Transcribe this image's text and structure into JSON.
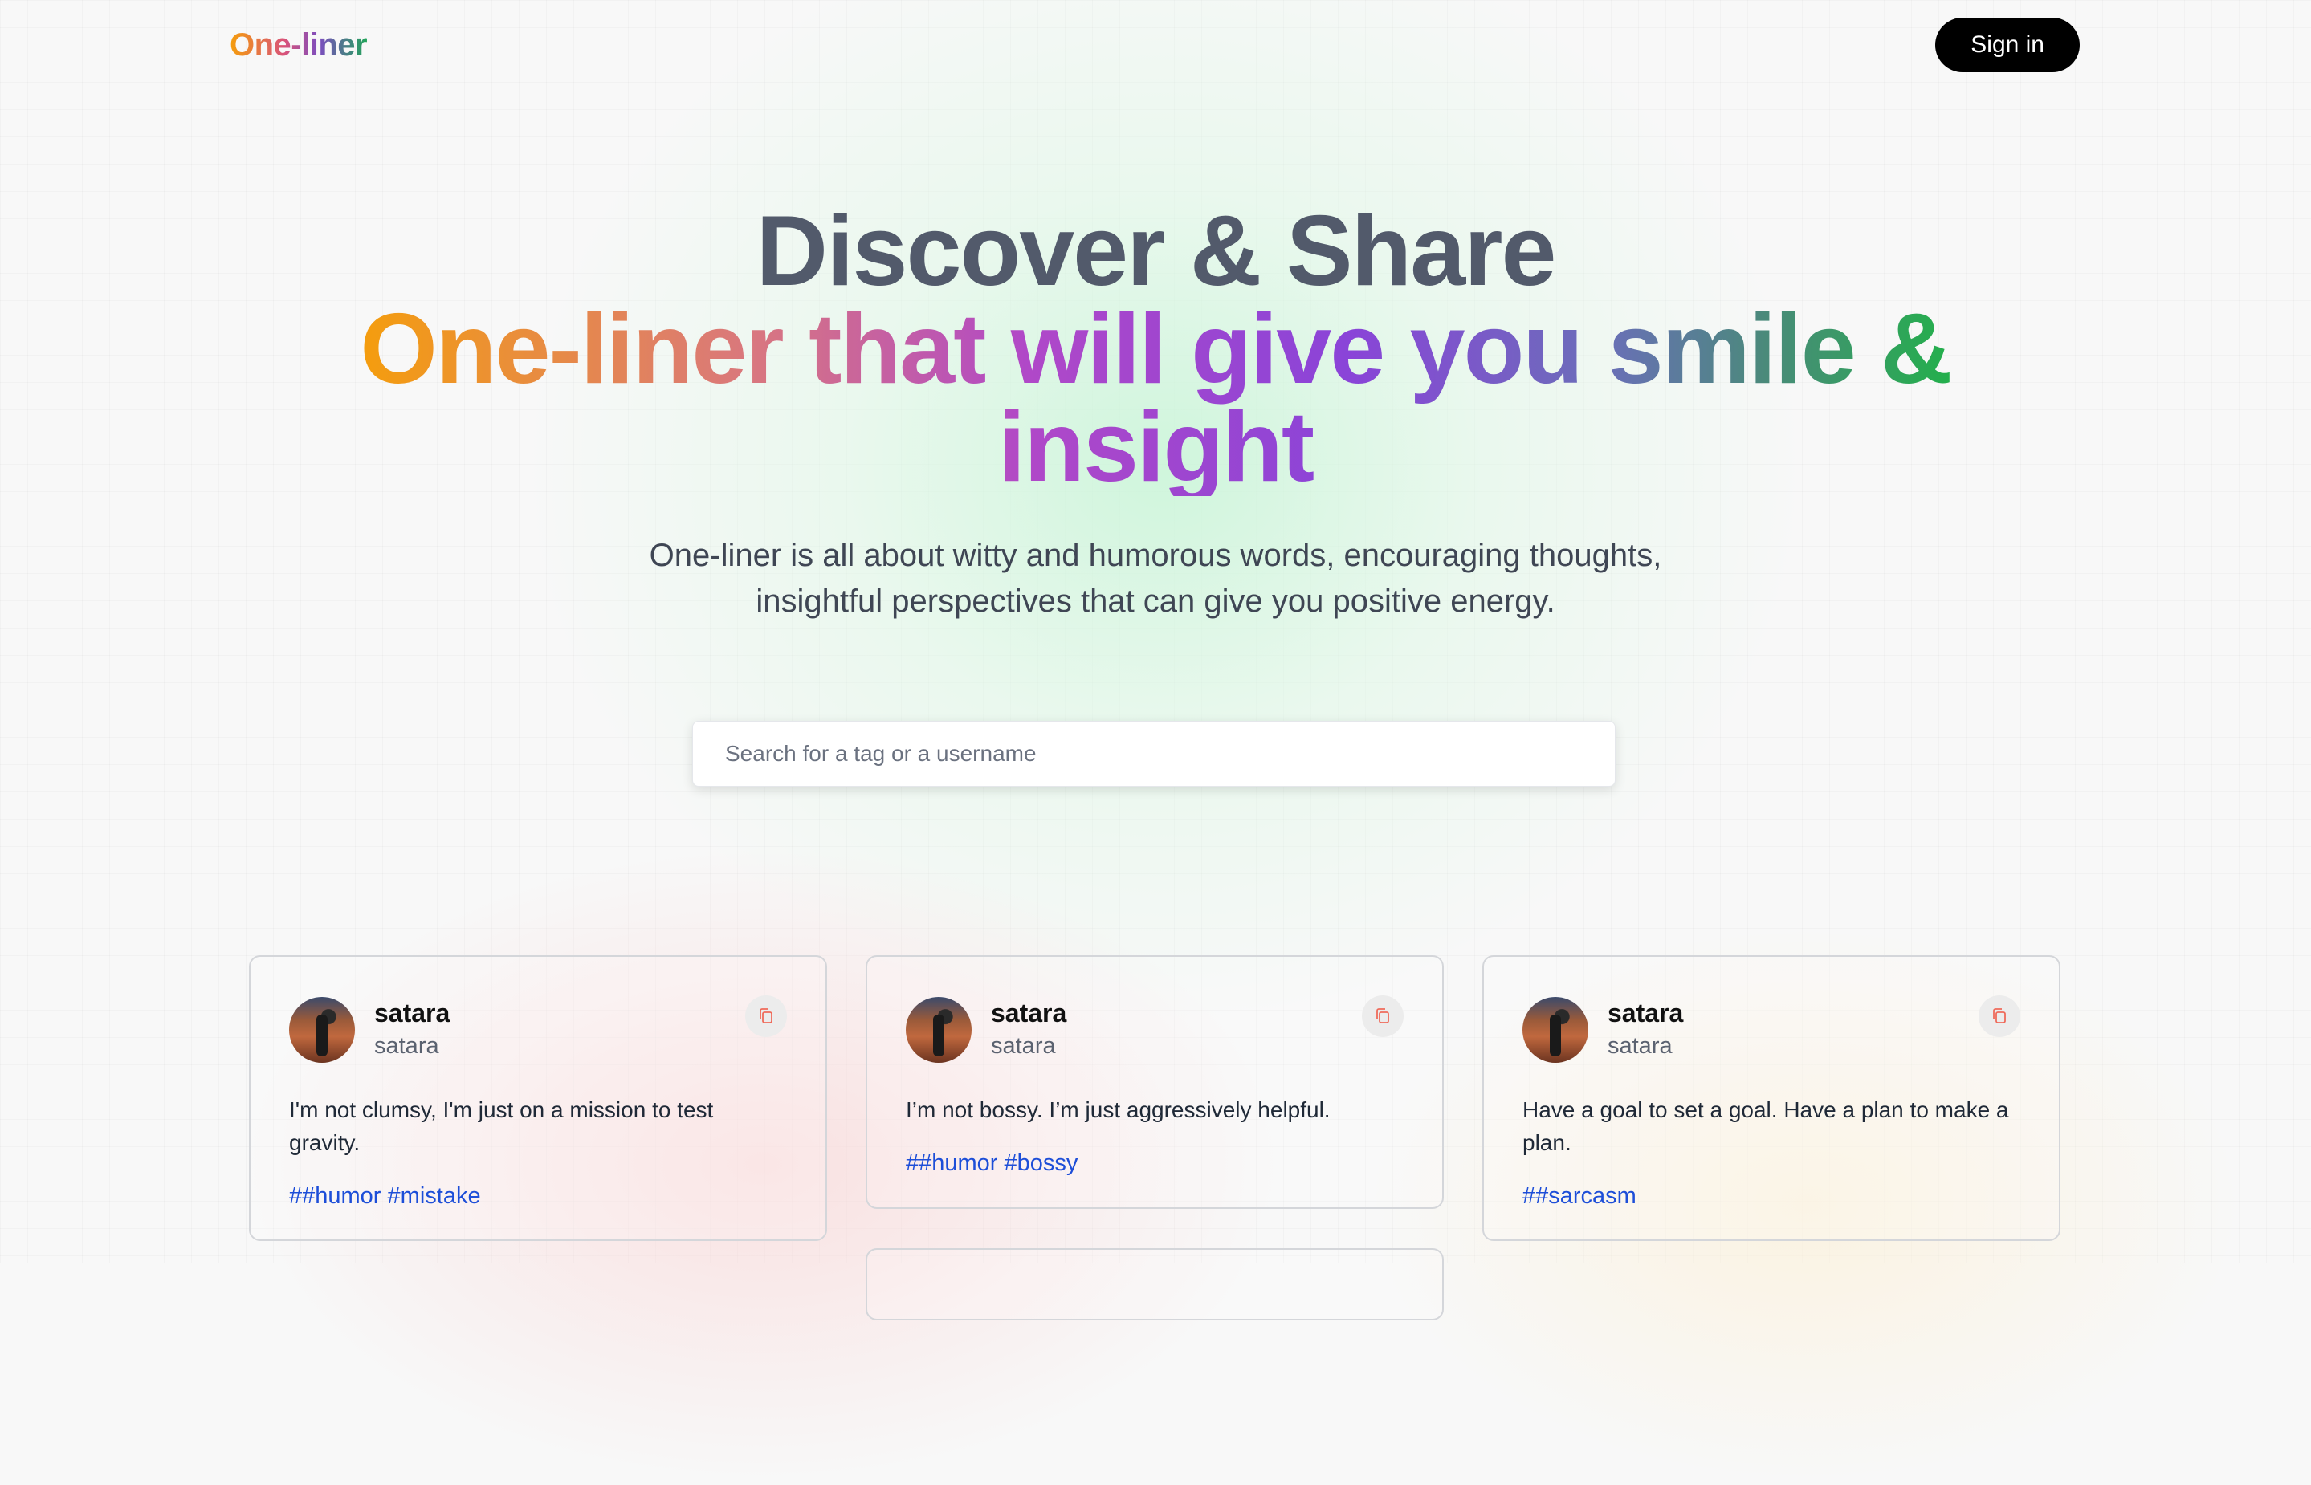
{
  "nav": {
    "logo": "One-liner",
    "signin_label": "Sign in"
  },
  "hero": {
    "title_line1": "Discover & Share",
    "title_line2": "One-liner that will give you smile & insight",
    "description": "One-liner is all about witty and humorous words, encouraging thoughts, insightful perspectives that can give you positive energy."
  },
  "search": {
    "placeholder": "Search for a tag or a username"
  },
  "posts": [
    {
      "username": "satara",
      "handle": "satara",
      "quote": "I'm not clumsy, I'm just on a mission to test gravity.",
      "tags": [
        "##humor",
        "#mistake"
      ],
      "copy_icon": "copy-icon"
    },
    {
      "username": "satara",
      "handle": "satara",
      "quote": "I’m not bossy. I’m just aggressively helpful.",
      "tags": [
        "##humor",
        "#bossy"
      ],
      "copy_icon": "copy-icon"
    },
    {
      "username": "satara",
      "handle": "satara",
      "quote": "Have a goal to set a goal. Have a plan to make a plan.",
      "tags": [
        "##sarcasm"
      ],
      "copy_icon": "copy-icon"
    }
  ],
  "colors": {
    "accent_orange": "#f59e0b",
    "accent_purple": "#8a44d8",
    "accent_green": "#22b14a",
    "tag_blue": "#1d4ed8",
    "button_black": "#000000"
  }
}
